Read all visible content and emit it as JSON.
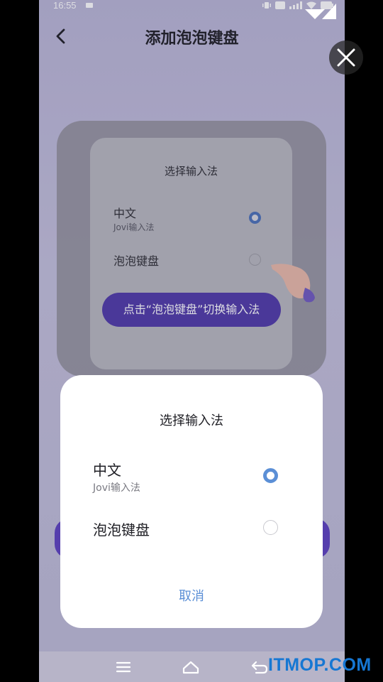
{
  "status_bar": {
    "time": "16:55"
  },
  "header": {
    "title": "添加泡泡键盘",
    "back_icon": "chevron-left-icon"
  },
  "close_icon": "close-icon",
  "illustration": {
    "title": "选择输入法",
    "option1_label": "中文",
    "option1_sub": "Jovi输入法",
    "option2_label": "泡泡键盘",
    "hint_pill": "点击“泡泡键盘”切换输入法"
  },
  "dialog": {
    "title": "选择输入法",
    "options": [
      {
        "label": "中文",
        "sub": "Jovi输入法",
        "selected": true
      },
      {
        "label": "泡泡键盘",
        "sub": "",
        "selected": false
      }
    ],
    "cancel_label": "取消"
  },
  "nav": {
    "items": [
      "menu-icon",
      "home-icon",
      "back-icon"
    ]
  },
  "watermark": "ITMOP.COM",
  "colors": {
    "accent": "#5b8fd6",
    "pill": "#4d38a8",
    "watermark": "#1677d3"
  }
}
